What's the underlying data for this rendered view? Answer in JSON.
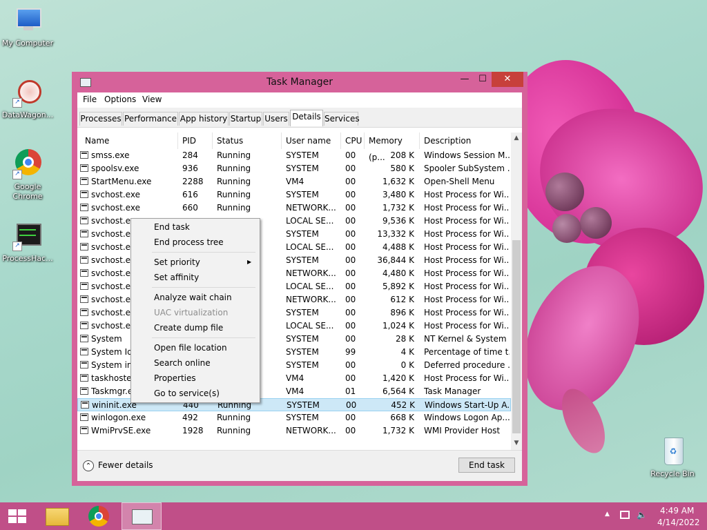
{
  "desktop": {
    "icons": [
      {
        "label": "My Computer"
      },
      {
        "label": "DataWagon..."
      },
      {
        "label": "Google Chrome"
      },
      {
        "label": "ProcessHac..."
      },
      {
        "label": "Recycle Bin"
      }
    ]
  },
  "window": {
    "title": "Task Manager",
    "controls": {
      "minimize": "—",
      "maximize": "☐",
      "close": "✕"
    },
    "menu": [
      "File",
      "Options",
      "View"
    ],
    "tabs": [
      "Processes",
      "Performance",
      "App history",
      "Startup",
      "Users",
      "Details",
      "Services"
    ],
    "active_tab": "Details",
    "columns": [
      "Name",
      "PID",
      "Status",
      "User name",
      "CPU",
      "Memory (p...",
      "Description"
    ],
    "sort_indicator": "˄",
    "rows": [
      {
        "name": "smss.exe",
        "pid": "284",
        "status": "Running",
        "user": "SYSTEM",
        "cpu": "00",
        "mem": "208 K",
        "desc": "Windows Session M..."
      },
      {
        "name": "spoolsv.exe",
        "pid": "936",
        "status": "Running",
        "user": "SYSTEM",
        "cpu": "00",
        "mem": "580 K",
        "desc": "Spooler SubSystem ..."
      },
      {
        "name": "StartMenu.exe",
        "pid": "2288",
        "status": "Running",
        "user": "VM4",
        "cpu": "00",
        "mem": "1,632 K",
        "desc": "Open-Shell Menu"
      },
      {
        "name": "svchost.exe",
        "pid": "616",
        "status": "Running",
        "user": "SYSTEM",
        "cpu": "00",
        "mem": "3,480 K",
        "desc": "Host Process for Wi..."
      },
      {
        "name": "svchost.exe",
        "pid": "660",
        "status": "Running",
        "user": "NETWORK...",
        "cpu": "00",
        "mem": "1,732 K",
        "desc": "Host Process for Wi..."
      },
      {
        "name": "svchost.exe",
        "pid": "",
        "status": "",
        "user": "LOCAL SE...",
        "cpu": "00",
        "mem": "9,536 K",
        "desc": "Host Process for Wi..."
      },
      {
        "name": "svchost.exe",
        "pid": "",
        "status": "",
        "user": "SYSTEM",
        "cpu": "00",
        "mem": "13,332 K",
        "desc": "Host Process for Wi..."
      },
      {
        "name": "svchost.exe",
        "pid": "",
        "status": "",
        "user": "LOCAL SE...",
        "cpu": "00",
        "mem": "4,488 K",
        "desc": "Host Process for Wi..."
      },
      {
        "name": "svchost.exe",
        "pid": "",
        "status": "",
        "user": "SYSTEM",
        "cpu": "00",
        "mem": "36,844 K",
        "desc": "Host Process for Wi..."
      },
      {
        "name": "svchost.exe",
        "pid": "",
        "status": "",
        "user": "NETWORK...",
        "cpu": "00",
        "mem": "4,480 K",
        "desc": "Host Process for Wi..."
      },
      {
        "name": "svchost.exe",
        "pid": "",
        "status": "",
        "user": "LOCAL SE...",
        "cpu": "00",
        "mem": "5,892 K",
        "desc": "Host Process for Wi..."
      },
      {
        "name": "svchost.exe",
        "pid": "",
        "status": "",
        "user": "NETWORK...",
        "cpu": "00",
        "mem": "612 K",
        "desc": "Host Process for Wi..."
      },
      {
        "name": "svchost.exe",
        "pid": "",
        "status": "",
        "user": "SYSTEM",
        "cpu": "00",
        "mem": "896 K",
        "desc": "Host Process for Wi..."
      },
      {
        "name": "svchost.exe",
        "pid": "",
        "status": "",
        "user": "LOCAL SE...",
        "cpu": "00",
        "mem": "1,024 K",
        "desc": "Host Process for Wi..."
      },
      {
        "name": "System",
        "pid": "",
        "status": "",
        "user": "SYSTEM",
        "cpu": "00",
        "mem": "28 K",
        "desc": "NT Kernel & System"
      },
      {
        "name": "System Idle Process",
        "pid": "",
        "status": "",
        "user": "SYSTEM",
        "cpu": "99",
        "mem": "4 K",
        "desc": "Percentage of time t..."
      },
      {
        "name": "System interrupts",
        "pid": "",
        "status": "",
        "user": "SYSTEM",
        "cpu": "00",
        "mem": "0 K",
        "desc": "Deferred procedure ..."
      },
      {
        "name": "taskhostex.exe",
        "pid": "",
        "status": "",
        "user": "VM4",
        "cpu": "00",
        "mem": "1,420 K",
        "desc": "Host Process for Wi..."
      },
      {
        "name": "Taskmgr.exe",
        "pid": "",
        "status": "",
        "user": "VM4",
        "cpu": "01",
        "mem": "6,564 K",
        "desc": "Task Manager"
      },
      {
        "name": "wininit.exe",
        "pid": "440",
        "status": "Running",
        "user": "SYSTEM",
        "cpu": "00",
        "mem": "452 K",
        "desc": "Windows Start-Up A..."
      },
      {
        "name": "winlogon.exe",
        "pid": "492",
        "status": "Running",
        "user": "SYSTEM",
        "cpu": "00",
        "mem": "668 K",
        "desc": "Windows Logon Ap..."
      },
      {
        "name": "WmiPrvSE.exe",
        "pid": "1928",
        "status": "Running",
        "user": "NETWORK...",
        "cpu": "00",
        "mem": "1,732 K",
        "desc": "WMI Provider Host"
      }
    ],
    "selected_row": 19,
    "fewer_details": "Fewer details",
    "end_task_button": "End task"
  },
  "context_menu": {
    "items": [
      {
        "label": "End task",
        "enabled": true
      },
      {
        "label": "End process tree",
        "enabled": true
      },
      {
        "label": "Set priority",
        "enabled": true,
        "submenu": true
      },
      {
        "label": "Set affinity",
        "enabled": true
      },
      {
        "label": "Analyze wait chain",
        "enabled": true
      },
      {
        "label": "UAC virtualization",
        "enabled": false
      },
      {
        "label": "Create dump file",
        "enabled": true
      },
      {
        "label": "Open file location",
        "enabled": true
      },
      {
        "label": "Search online",
        "enabled": true
      },
      {
        "label": "Properties",
        "enabled": true
      },
      {
        "label": "Go to service(s)",
        "enabled": true
      }
    ]
  },
  "taskbar": {
    "clock_time": "4:49 AM",
    "clock_date": "4/14/2022"
  }
}
